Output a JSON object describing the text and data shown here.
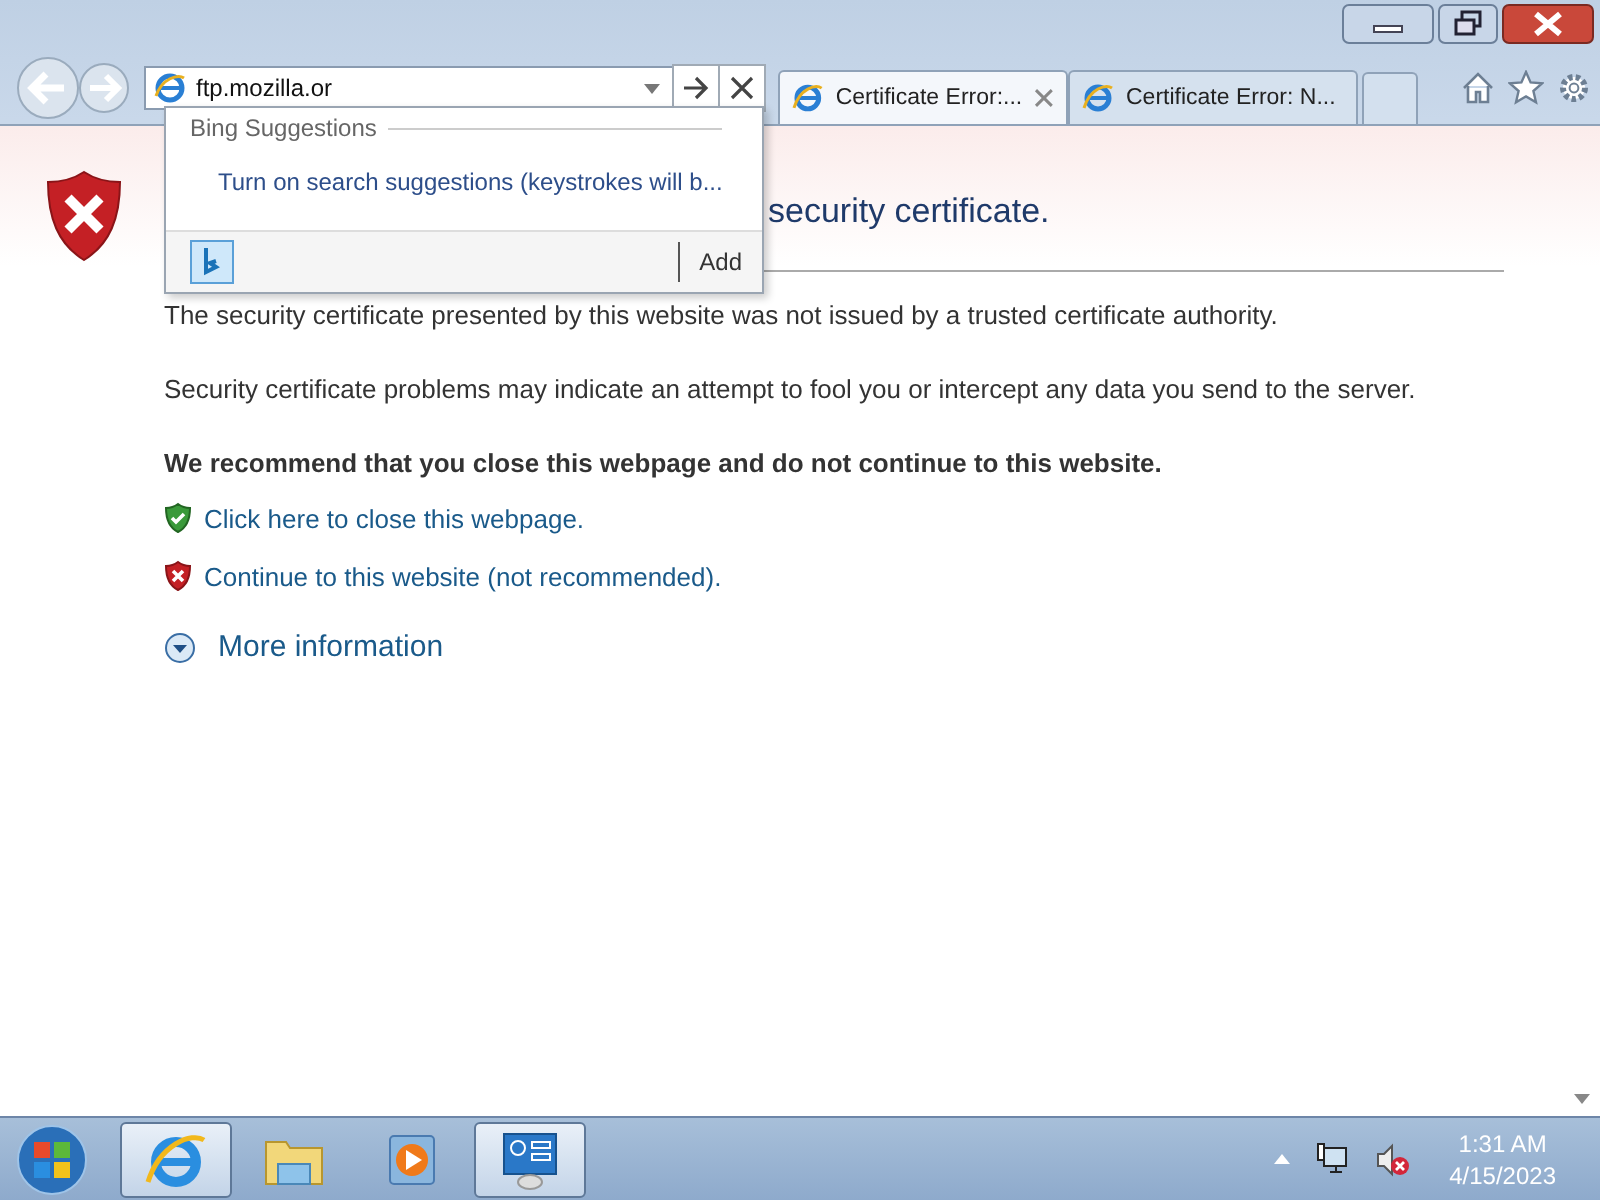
{
  "address_bar": {
    "value": "ftp.mozilla.or"
  },
  "suggestions": {
    "header": "Bing Suggestions",
    "items": [
      "Turn on search suggestions (keystrokes will b..."
    ],
    "add_label": "Add"
  },
  "tabs": [
    {
      "label": "Certificate Error:...",
      "selected": true
    },
    {
      "label": "Certificate Error: N...",
      "selected": false
    }
  ],
  "page": {
    "heading": "security certificate.",
    "paragraphs": [
      "The security certificate presented by this website was not issued by a trusted certificate authority.",
      "Security certificate problems may indicate an attempt to fool you or intercept any data you send to the server."
    ],
    "recommendation": "We recommend that you close this webpage and do not continue to this website.",
    "actions": [
      {
        "kind": "safe",
        "label": "Click here to close this webpage."
      },
      {
        "kind": "unsafe",
        "label": "Continue to this website (not recommended)."
      }
    ],
    "more_info": "More information"
  },
  "taskbar": {
    "items": [
      {
        "kind": "browser",
        "running": true
      },
      {
        "kind": "folder",
        "running": false
      },
      {
        "kind": "media",
        "running": false
      },
      {
        "kind": "control-panel",
        "running": true
      }
    ],
    "time": "1:31 AM",
    "date": "4/15/2023"
  }
}
